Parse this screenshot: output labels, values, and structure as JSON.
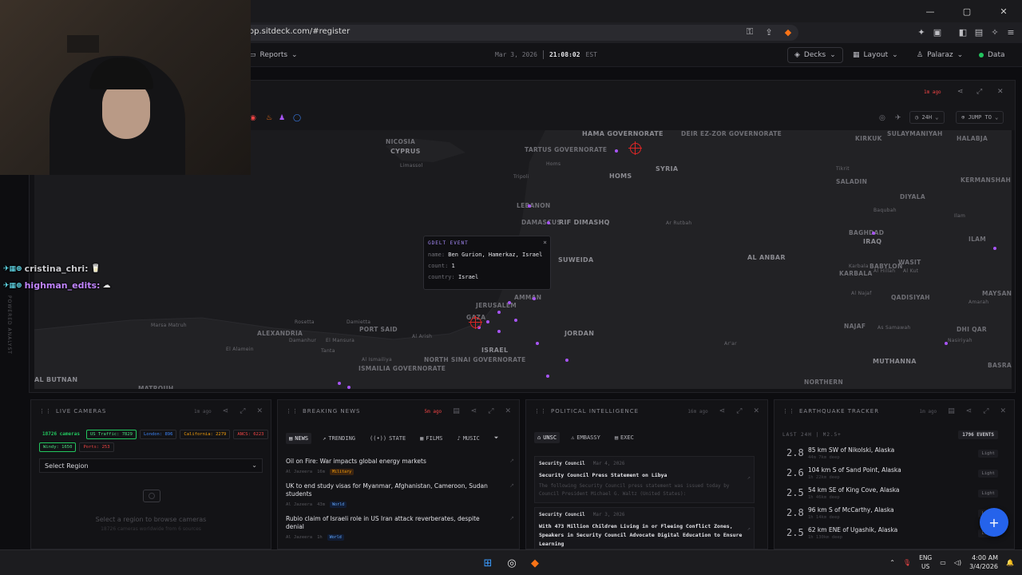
{
  "browser": {
    "url": "op.sitdeck.com/#register",
    "window_controls": [
      "—",
      "▢",
      "✕"
    ]
  },
  "header": {
    "reports_label": "Reports",
    "date": "Mar 3, 2026",
    "time": "21:08:02",
    "tz": "EST",
    "decks_label": "Decks",
    "layout_label": "Layout",
    "user_label": "Palaraz",
    "data_label": "Data"
  },
  "map": {
    "last_update": "1m ago",
    "range_label": "24H",
    "jump_label": "JUMP TO",
    "labels": [
      {
        "text": "HAMA GOVERNORATE",
        "cls": "big"
      },
      {
        "text": "DEIR EZ-ZOR GOVERNORATE",
        "cls": ""
      },
      {
        "text": "SULAYMANIYAH",
        "cls": ""
      },
      {
        "text": "HALABJA",
        "cls": ""
      },
      {
        "text": "NICOSIA",
        "cls": ""
      },
      {
        "text": "CYPRUS",
        "cls": "big"
      },
      {
        "text": "Limassol",
        "cls": "city"
      },
      {
        "text": "TARTUS GOVERNORATE",
        "cls": ""
      },
      {
        "text": "Homs",
        "cls": "city"
      },
      {
        "text": "HOMS",
        "cls": "big"
      },
      {
        "text": "SYRIA",
        "cls": "big"
      },
      {
        "text": "KIRKUK",
        "cls": ""
      },
      {
        "text": "KERMANSHAH",
        "cls": ""
      },
      {
        "text": "Tripoli",
        "cls": "city"
      },
      {
        "text": "SALADIN",
        "cls": ""
      },
      {
        "text": "Tikrit",
        "cls": "city"
      },
      {
        "text": "LEBANON",
        "cls": ""
      },
      {
        "text": "DAMASCUS",
        "cls": ""
      },
      {
        "text": "RIF DIMASHQ",
        "cls": "big"
      },
      {
        "text": "DIYALA",
        "cls": ""
      },
      {
        "text": "Baqubah",
        "cls": "city"
      },
      {
        "text": "Ilam",
        "cls": "city"
      },
      {
        "text": "BAGHDAD",
        "cls": ""
      },
      {
        "text": "IRAQ",
        "cls": "big"
      },
      {
        "text": "ILAM",
        "cls": ""
      },
      {
        "text": "Ar Rutbah",
        "cls": "city"
      },
      {
        "text": "SUWEIDA",
        "cls": "big"
      },
      {
        "text": "AL ANBAR",
        "cls": "big"
      },
      {
        "text": "Karbala",
        "cls": "city"
      },
      {
        "text": "BABYLON",
        "cls": ""
      },
      {
        "text": "WASIT",
        "cls": ""
      },
      {
        "text": "KARBALA",
        "cls": ""
      },
      {
        "text": "Al Hillah",
        "cls": "city"
      },
      {
        "text": "Al Kut",
        "cls": "city"
      },
      {
        "text": "AMMAN",
        "cls": ""
      },
      {
        "text": "JERUSALEM",
        "cls": ""
      },
      {
        "text": "QADISIYAH",
        "cls": ""
      },
      {
        "text": "MAYSAN",
        "cls": ""
      },
      {
        "text": "Al Najaf",
        "cls": "city"
      },
      {
        "text": "Amarah",
        "cls": "city"
      },
      {
        "text": "Marsa Matruh",
        "cls": "city"
      },
      {
        "text": "ALEXANDRIA",
        "cls": ""
      },
      {
        "text": "Rosetta",
        "cls": "city"
      },
      {
        "text": "Damietta",
        "cls": "city"
      },
      {
        "text": "PORT SAID",
        "cls": ""
      },
      {
        "text": "GAZA",
        "cls": ""
      },
      {
        "text": "JORDAN",
        "cls": "big"
      },
      {
        "text": "NAJAF",
        "cls": ""
      },
      {
        "text": "As Samawah",
        "cls": "city"
      },
      {
        "text": "DHI QAR",
        "cls": ""
      },
      {
        "text": "Damanhur",
        "cls": "city"
      },
      {
        "text": "El Mansura",
        "cls": "city"
      },
      {
        "text": "Al Arish",
        "cls": "city"
      },
      {
        "text": "Nasiriyah",
        "cls": "city"
      },
      {
        "text": "El Alamein",
        "cls": "city"
      },
      {
        "text": "Tanta",
        "cls": "city"
      },
      {
        "text": "ISRAEL",
        "cls": "big"
      },
      {
        "text": "Ar'ar",
        "cls": "city"
      },
      {
        "text": "NORTH SINAI GOVERNORATE",
        "cls": ""
      },
      {
        "text": "Al Ismailiya",
        "cls": "city"
      },
      {
        "text": "ISMAILIA GOVERNORATE",
        "cls": ""
      },
      {
        "text": "MUTHANNA",
        "cls": "big"
      },
      {
        "text": "BASRA",
        "cls": ""
      },
      {
        "text": "AL BUTNAN",
        "cls": "big"
      },
      {
        "text": "MATROUH",
        "cls": ""
      },
      {
        "text": "NORTHERN",
        "cls": ""
      }
    ]
  },
  "popup": {
    "title": "GDELT EVENT",
    "name_label": "name:",
    "name_value": "Ben Gurion, Hamerkaz, Israel",
    "count_label": "count:",
    "count_value": "1",
    "country_label": "country:",
    "country_value": "Israel",
    "close": "×"
  },
  "chat": [
    {
      "user": "cristina_chri:",
      "color": "#e5e5e5",
      "emote": "🥛"
    },
    {
      "user": "highman_edits:",
      "color": "#c084fc",
      "emote": "☁"
    }
  ],
  "powered_by": "POWERED ANALYST",
  "cameras": {
    "title": "LIVE CAMERAS",
    "ago": "1m ago",
    "tags": [
      {
        "text": "18726 cameras",
        "cls": "green"
      },
      {
        "text": "US Traffic: 7829",
        "cls": "green-box"
      },
      {
        "text": "London: 896",
        "cls": "blue"
      },
      {
        "text": "California: 2279",
        "cls": "orange"
      },
      {
        "text": "ANCS: 6223",
        "cls": "red"
      },
      {
        "text": "Windy: 1650",
        "cls": "green-box"
      },
      {
        "text": "Ports: 253",
        "cls": "red"
      }
    ],
    "select_label": "Select Region",
    "empty_text": "Select a region to browse cameras",
    "empty_sub": "18726 cameras worldwide from 6 sources"
  },
  "news": {
    "title": "BREAKING NEWS",
    "ago": "5m ago",
    "tabs": [
      "NEWS",
      "TRENDING",
      "STATE",
      "FILMS",
      "MUSIC"
    ],
    "items": [
      {
        "title": "Oil on Fire: War impacts global energy markets",
        "source": "Al Jazeera",
        "time": "16m",
        "tag": "Military",
        "tag_cls": "mil"
      },
      {
        "title": "UK to end study visas for Myanmar, Afghanistan, Cameroon, Sudan students",
        "source": "Al Jazeera",
        "time": "43m",
        "tag": "World",
        "tag_cls": "world"
      },
      {
        "title": "Rubio claim of Israeli role in US Iran attack reverberates, despite denial",
        "source": "Al Jazeera",
        "time": "1h",
        "tag": "World",
        "tag_cls": "world"
      }
    ]
  },
  "political": {
    "title": "POLITICAL INTELLIGENCE",
    "ago": "16m ago",
    "tabs": [
      "UNSC",
      "EMBASSY",
      "EXEC"
    ],
    "items": [
      {
        "source": "Security Council",
        "date": "Mar 4, 2026",
        "title": "Security Council Press Statement on Libya",
        "body": "The following Security Council press statement was issued today by Council President Michael G. Waltz (United States):"
      },
      {
        "source": "Security Council",
        "date": "Mar 3, 2026",
        "title": "With 473 Million Children Living in or Fleeing Conflict Zones, Speakers in Security Council Advocate Digital Education to Ensure Learning",
        "body": ""
      }
    ]
  },
  "quakes": {
    "title": "EARTHQUAKE TRACKER",
    "ago": "1m ago",
    "sub": "LAST 24H | M2.5+",
    "count": "1796 EVENTS",
    "items": [
      {
        "mag": "2.8",
        "place": "85 km SW of Nikolski, Alaska",
        "time": "44m  7km deep",
        "sev": "Light"
      },
      {
        "mag": "2.6",
        "place": "104 km S of Sand Point, Alaska",
        "time": "1h  22km deep",
        "sev": "Light"
      },
      {
        "mag": "2.5",
        "place": "54 km SE of King Cove, Alaska",
        "time": "1h  46km deep",
        "sev": "Light"
      },
      {
        "mag": "2.8",
        "place": "96 km S of McCarthy, Alaska",
        "time": "1h  14km deep",
        "sev": "Light"
      },
      {
        "mag": "2.5",
        "place": "62 km ENE of Ugashik, Alaska",
        "time": "1h  130km deep",
        "sev": "Light"
      }
    ]
  },
  "taskbar": {
    "lang_top": "ENG",
    "lang_bottom": "US",
    "time": "4:00 AM",
    "date": "3/4/2026"
  },
  "colors": {
    "accent_purple": "#a855f7",
    "target_red": "#dc2626",
    "fab_blue": "#2563eb"
  }
}
